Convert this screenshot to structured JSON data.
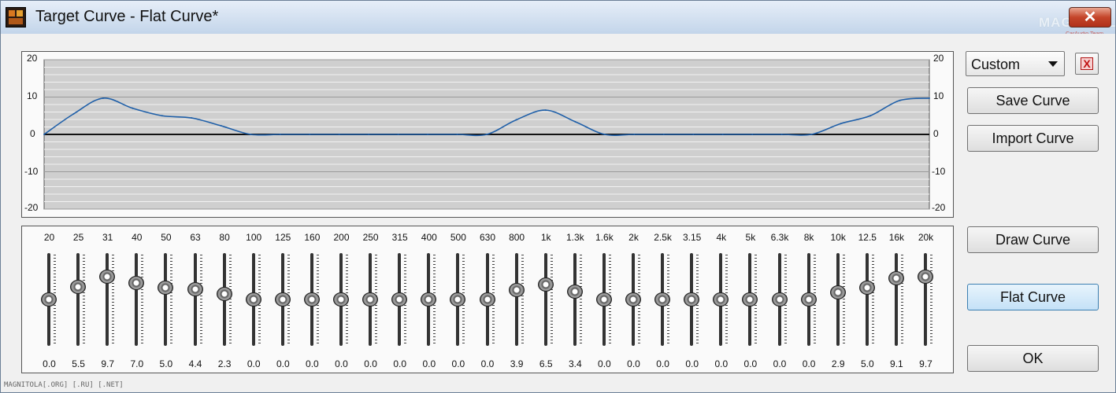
{
  "window": {
    "title": "Target Curve - Flat Curve*",
    "close_glyph": "✕",
    "watermark_top": "MAGNITOLA",
    "watermark_sub": "CarAudio Team",
    "watermark_bottom": "MAGNITOLA[.ORG] [.RU] [.NET]"
  },
  "preset": {
    "selected": "Custom"
  },
  "buttons": {
    "delete_glyph": "X",
    "save": "Save Curve",
    "import": "Import Curve",
    "draw": "Draw Curve",
    "flat": "Flat Curve",
    "ok": "OK"
  },
  "graph_labels": {
    "left": [
      "20",
      "10",
      "0",
      "-10",
      "-20"
    ],
    "right": [
      "20",
      "10",
      "0",
      "-10",
      "-20"
    ]
  },
  "chart_data": {
    "type": "line",
    "ylim": [
      -20,
      20
    ],
    "grid": true,
    "line_color": "#1f5fa8",
    "zero_line_color": "#111111",
    "x": [
      "20",
      "25",
      "31",
      "40",
      "50",
      "63",
      "80",
      "100",
      "125",
      "160",
      "200",
      "250",
      "315",
      "400",
      "500",
      "630",
      "800",
      "1k",
      "1.3k",
      "1.6k",
      "2k",
      "2.5k",
      "3.15",
      "4k",
      "5k",
      "6.3k",
      "8k",
      "10k",
      "12.5",
      "16k",
      "20k"
    ],
    "values": [
      0.0,
      5.5,
      9.7,
      7.0,
      5.0,
      4.4,
      2.3,
      0.0,
      0.0,
      0.0,
      0.0,
      0.0,
      0.0,
      0.0,
      0.0,
      0.0,
      3.9,
      6.5,
      3.4,
      0.0,
      0.0,
      0.0,
      0.0,
      0.0,
      0.0,
      0.0,
      0.0,
      2.9,
      5.0,
      9.1,
      9.7
    ]
  },
  "bands": [
    {
      "freq": "20",
      "value": "0.0"
    },
    {
      "freq": "25",
      "value": "5.5"
    },
    {
      "freq": "31",
      "value": "9.7"
    },
    {
      "freq": "40",
      "value": "7.0"
    },
    {
      "freq": "50",
      "value": "5.0"
    },
    {
      "freq": "63",
      "value": "4.4"
    },
    {
      "freq": "80",
      "value": "2.3"
    },
    {
      "freq": "100",
      "value": "0.0"
    },
    {
      "freq": "125",
      "value": "0.0"
    },
    {
      "freq": "160",
      "value": "0.0"
    },
    {
      "freq": "200",
      "value": "0.0"
    },
    {
      "freq": "250",
      "value": "0.0"
    },
    {
      "freq": "315",
      "value": "0.0"
    },
    {
      "freq": "400",
      "value": "0.0"
    },
    {
      "freq": "500",
      "value": "0.0"
    },
    {
      "freq": "630",
      "value": "0.0"
    },
    {
      "freq": "800",
      "value": "3.9"
    },
    {
      "freq": "1k",
      "value": "6.5"
    },
    {
      "freq": "1.3k",
      "value": "3.4"
    },
    {
      "freq": "1.6k",
      "value": "0.0"
    },
    {
      "freq": "2k",
      "value": "0.0"
    },
    {
      "freq": "2.5k",
      "value": "0.0"
    },
    {
      "freq": "3.15",
      "value": "0.0"
    },
    {
      "freq": "4k",
      "value": "0.0"
    },
    {
      "freq": "5k",
      "value": "0.0"
    },
    {
      "freq": "6.3k",
      "value": "0.0"
    },
    {
      "freq": "8k",
      "value": "0.0"
    },
    {
      "freq": "10k",
      "value": "2.9"
    },
    {
      "freq": "12.5",
      "value": "5.0"
    },
    {
      "freq": "16k",
      "value": "9.1"
    },
    {
      "freq": "20k",
      "value": "9.7"
    }
  ],
  "slider_range": [
    -20,
    20
  ]
}
